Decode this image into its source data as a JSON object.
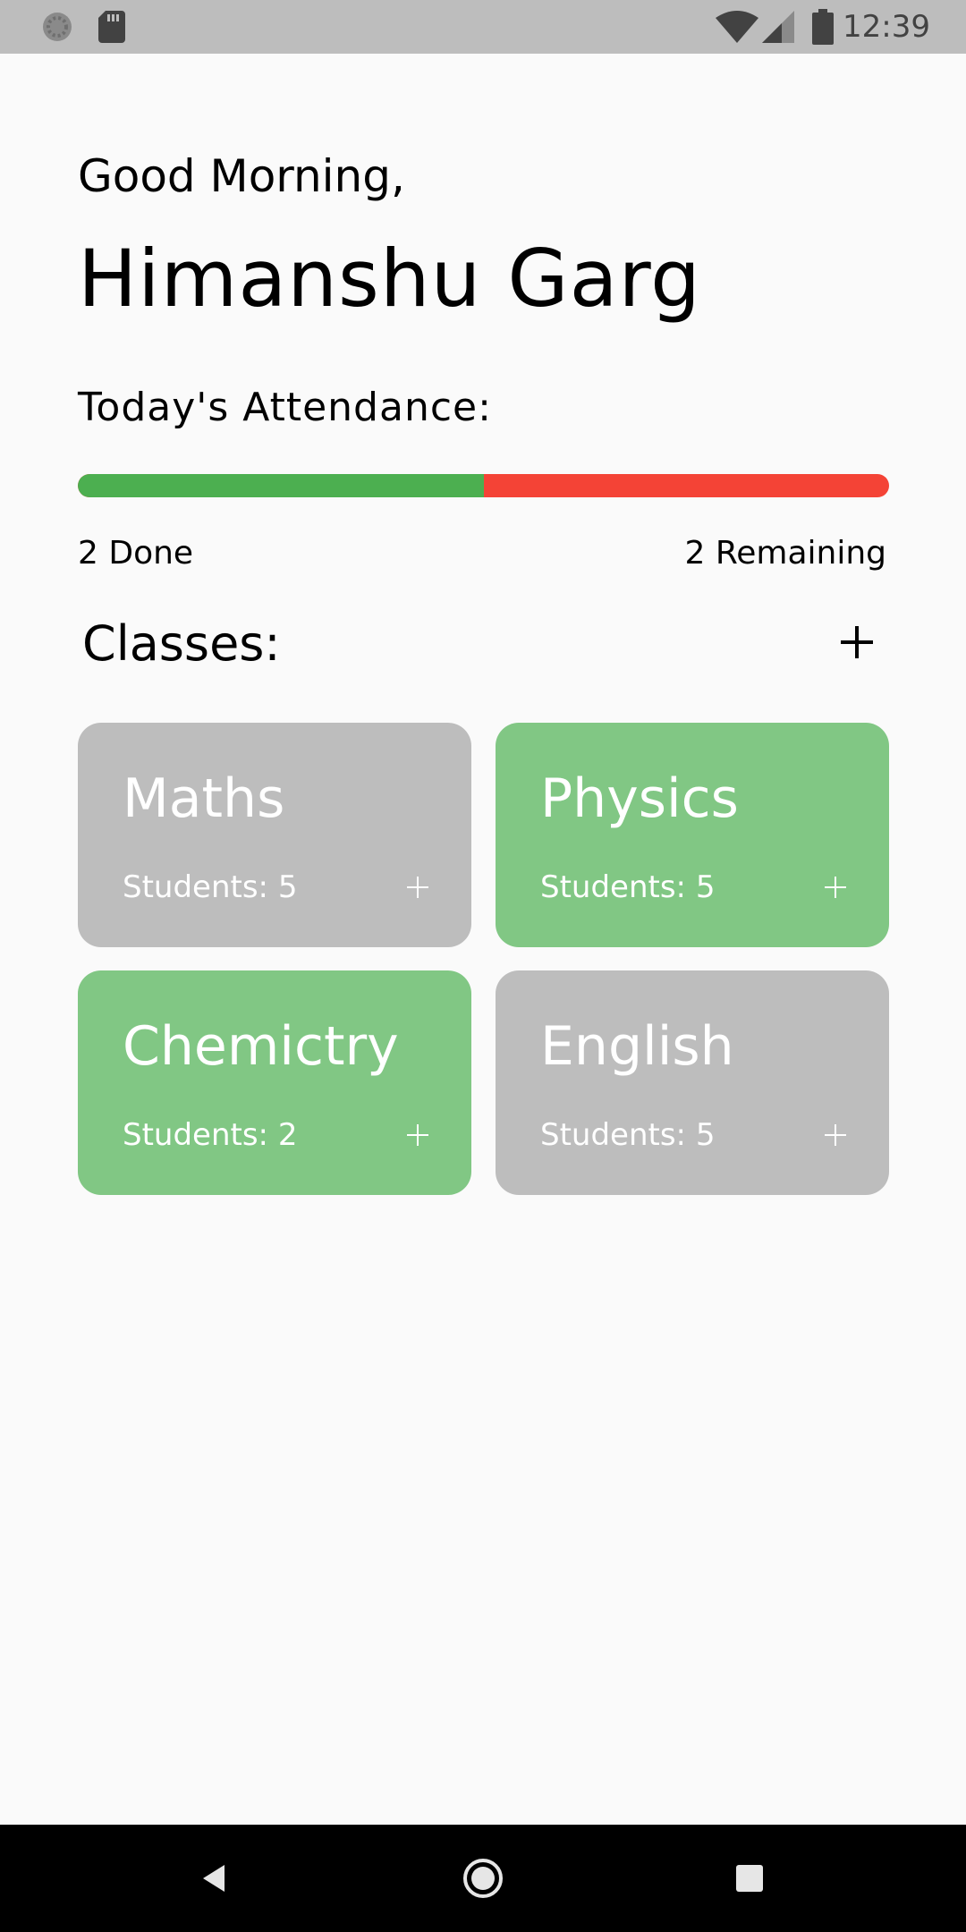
{
  "status_bar": {
    "time": "12:39",
    "background": "#bdbdbd",
    "icons": [
      "sync-icon",
      "sd-card-icon",
      "wifi-icon",
      "cell-signal-icon",
      "battery-icon"
    ]
  },
  "header": {
    "greeting": "Good Morning,",
    "user_name": "Himanshu Garg"
  },
  "attendance": {
    "label": "Today's Attendance:",
    "done_fraction": 0.5,
    "done_text": "2 Done",
    "remaining_text": "2 Remaining",
    "done_color": "#4caf50",
    "remaining_color": "#f44336"
  },
  "classes": {
    "title": "Classes:",
    "add_icon": "plus-icon",
    "items": [
      {
        "name": "Maths",
        "students": "Students: 5",
        "status": "pending",
        "color": "#bdbdbd"
      },
      {
        "name": "Physics",
        "students": "Students: 5",
        "status": "done",
        "color": "#81c784"
      },
      {
        "name": "Chemictry",
        "students": "Students: 2",
        "status": "done",
        "color": "#81c784"
      },
      {
        "name": "English",
        "students": "Students: 5",
        "status": "pending",
        "color": "#bdbdbd"
      }
    ]
  },
  "nav_bar": {
    "buttons": [
      "back-icon",
      "home-icon",
      "recents-icon"
    ]
  }
}
